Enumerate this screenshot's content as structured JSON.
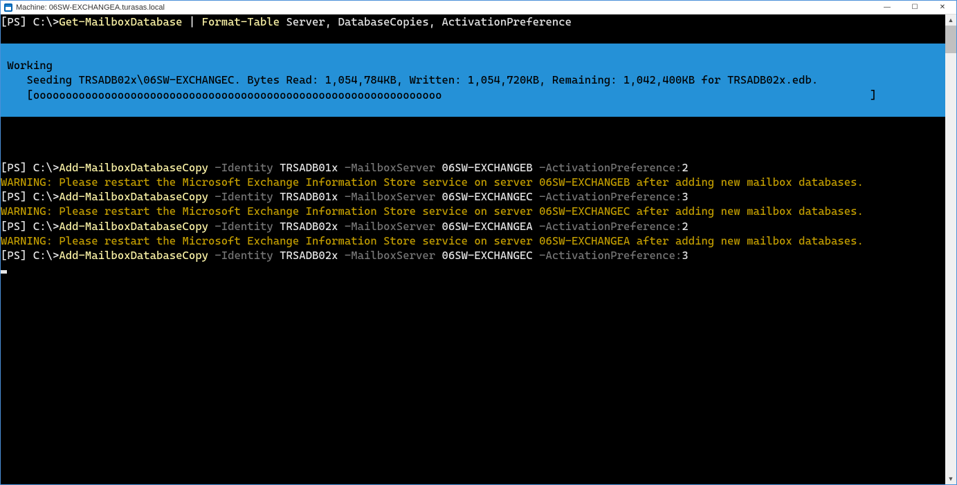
{
  "window": {
    "title": "Machine: 06SW-EXCHANGEA.turasas.local",
    "minimize": "—",
    "maximize": "☐",
    "close": "✕"
  },
  "prompt": "[PS] C:\\>",
  "line1": {
    "cmd": "Get-MailboxDatabase",
    "pipe": " | ",
    "cmd2": "Format-Table",
    "args": " Server, DatabaseCopies, ActivationPreference"
  },
  "progress": {
    "blank_top": " ",
    "status": " Working",
    "detail": "    Seeding TRSADB02x\\06SW-EXCHANGEC. Bytes Read: 1,054,784KB, Written: 1,054,720KB, Remaining: 1,042,400KB for TRSADB02x.edb. ",
    "bar": "    [ooooooooooooooooooooooooooooooooooooooooooooooooooooooooooooooo                                                                  ]",
    "blank_bottom": " "
  },
  "cmds": [
    {
      "cmd": "Add-MailboxDatabaseCopy",
      "p_id": " -Identity ",
      "id": "TRSADB01x",
      "p_srv": " -MailboxServer ",
      "srv": "06SW-EXCHANGEB",
      "p_ap": " -ActivationPreference:",
      "ap": "2"
    },
    {
      "cmd": "Add-MailboxDatabaseCopy",
      "p_id": " -Identity ",
      "id": "TRSADB01x",
      "p_srv": " -MailboxServer ",
      "srv": "06SW-EXCHANGEC",
      "p_ap": " -ActivationPreference:",
      "ap": "3"
    },
    {
      "cmd": "Add-MailboxDatabaseCopy",
      "p_id": " -Identity ",
      "id": "TRSADB02x",
      "p_srv": " -MailboxServer ",
      "srv": "06SW-EXCHANGEA",
      "p_ap": " -ActivationPreference:",
      "ap": "2"
    },
    {
      "cmd": "Add-MailboxDatabaseCopy",
      "p_id": " -Identity ",
      "id": "TRSADB02x",
      "p_srv": " -MailboxServer ",
      "srv": "06SW-EXCHANGEC",
      "p_ap": " -ActivationPreference:",
      "ap": "3"
    }
  ],
  "warnings": [
    "WARNING: Please restart the Microsoft Exchange Information Store service on server 06SW-EXCHANGEB after adding new mailbox databases.",
    "WARNING: Please restart the Microsoft Exchange Information Store service on server 06SW-EXCHANGEC after adding new mailbox databases.",
    "WARNING: Please restart the Microsoft Exchange Information Store service on server 06SW-EXCHANGEA after adding new mailbox databases."
  ]
}
